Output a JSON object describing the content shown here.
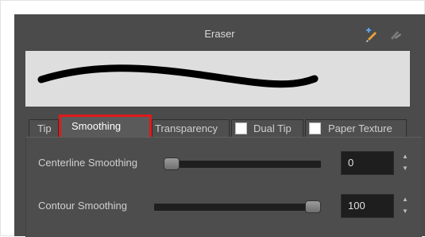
{
  "window": {
    "title": "Eraser"
  },
  "toolbar": {
    "icons": [
      "create-brush-icon",
      "delete-brush-icon"
    ]
  },
  "tabs": [
    {
      "label": "Tip",
      "active": false,
      "has_checkbox": false
    },
    {
      "label": "Smoothing",
      "active": true,
      "has_checkbox": false
    },
    {
      "label": "Transparency",
      "active": false,
      "has_checkbox": false
    },
    {
      "label": "Dual Tip",
      "active": false,
      "has_checkbox": true,
      "checked": false
    },
    {
      "label": "Paper Texture",
      "active": false,
      "has_checkbox": true,
      "checked": false
    }
  ],
  "settings": {
    "centerline": {
      "label": "Centerline Smoothing",
      "value": "0",
      "slider_fraction": 0.0
    },
    "contour": {
      "label": "Contour Smoothing",
      "value": "100",
      "slider_fraction": 1.0
    }
  },
  "colors": {
    "highlight": "#e0191b",
    "panel": "#4b4b4b",
    "stroke": "#000000"
  }
}
